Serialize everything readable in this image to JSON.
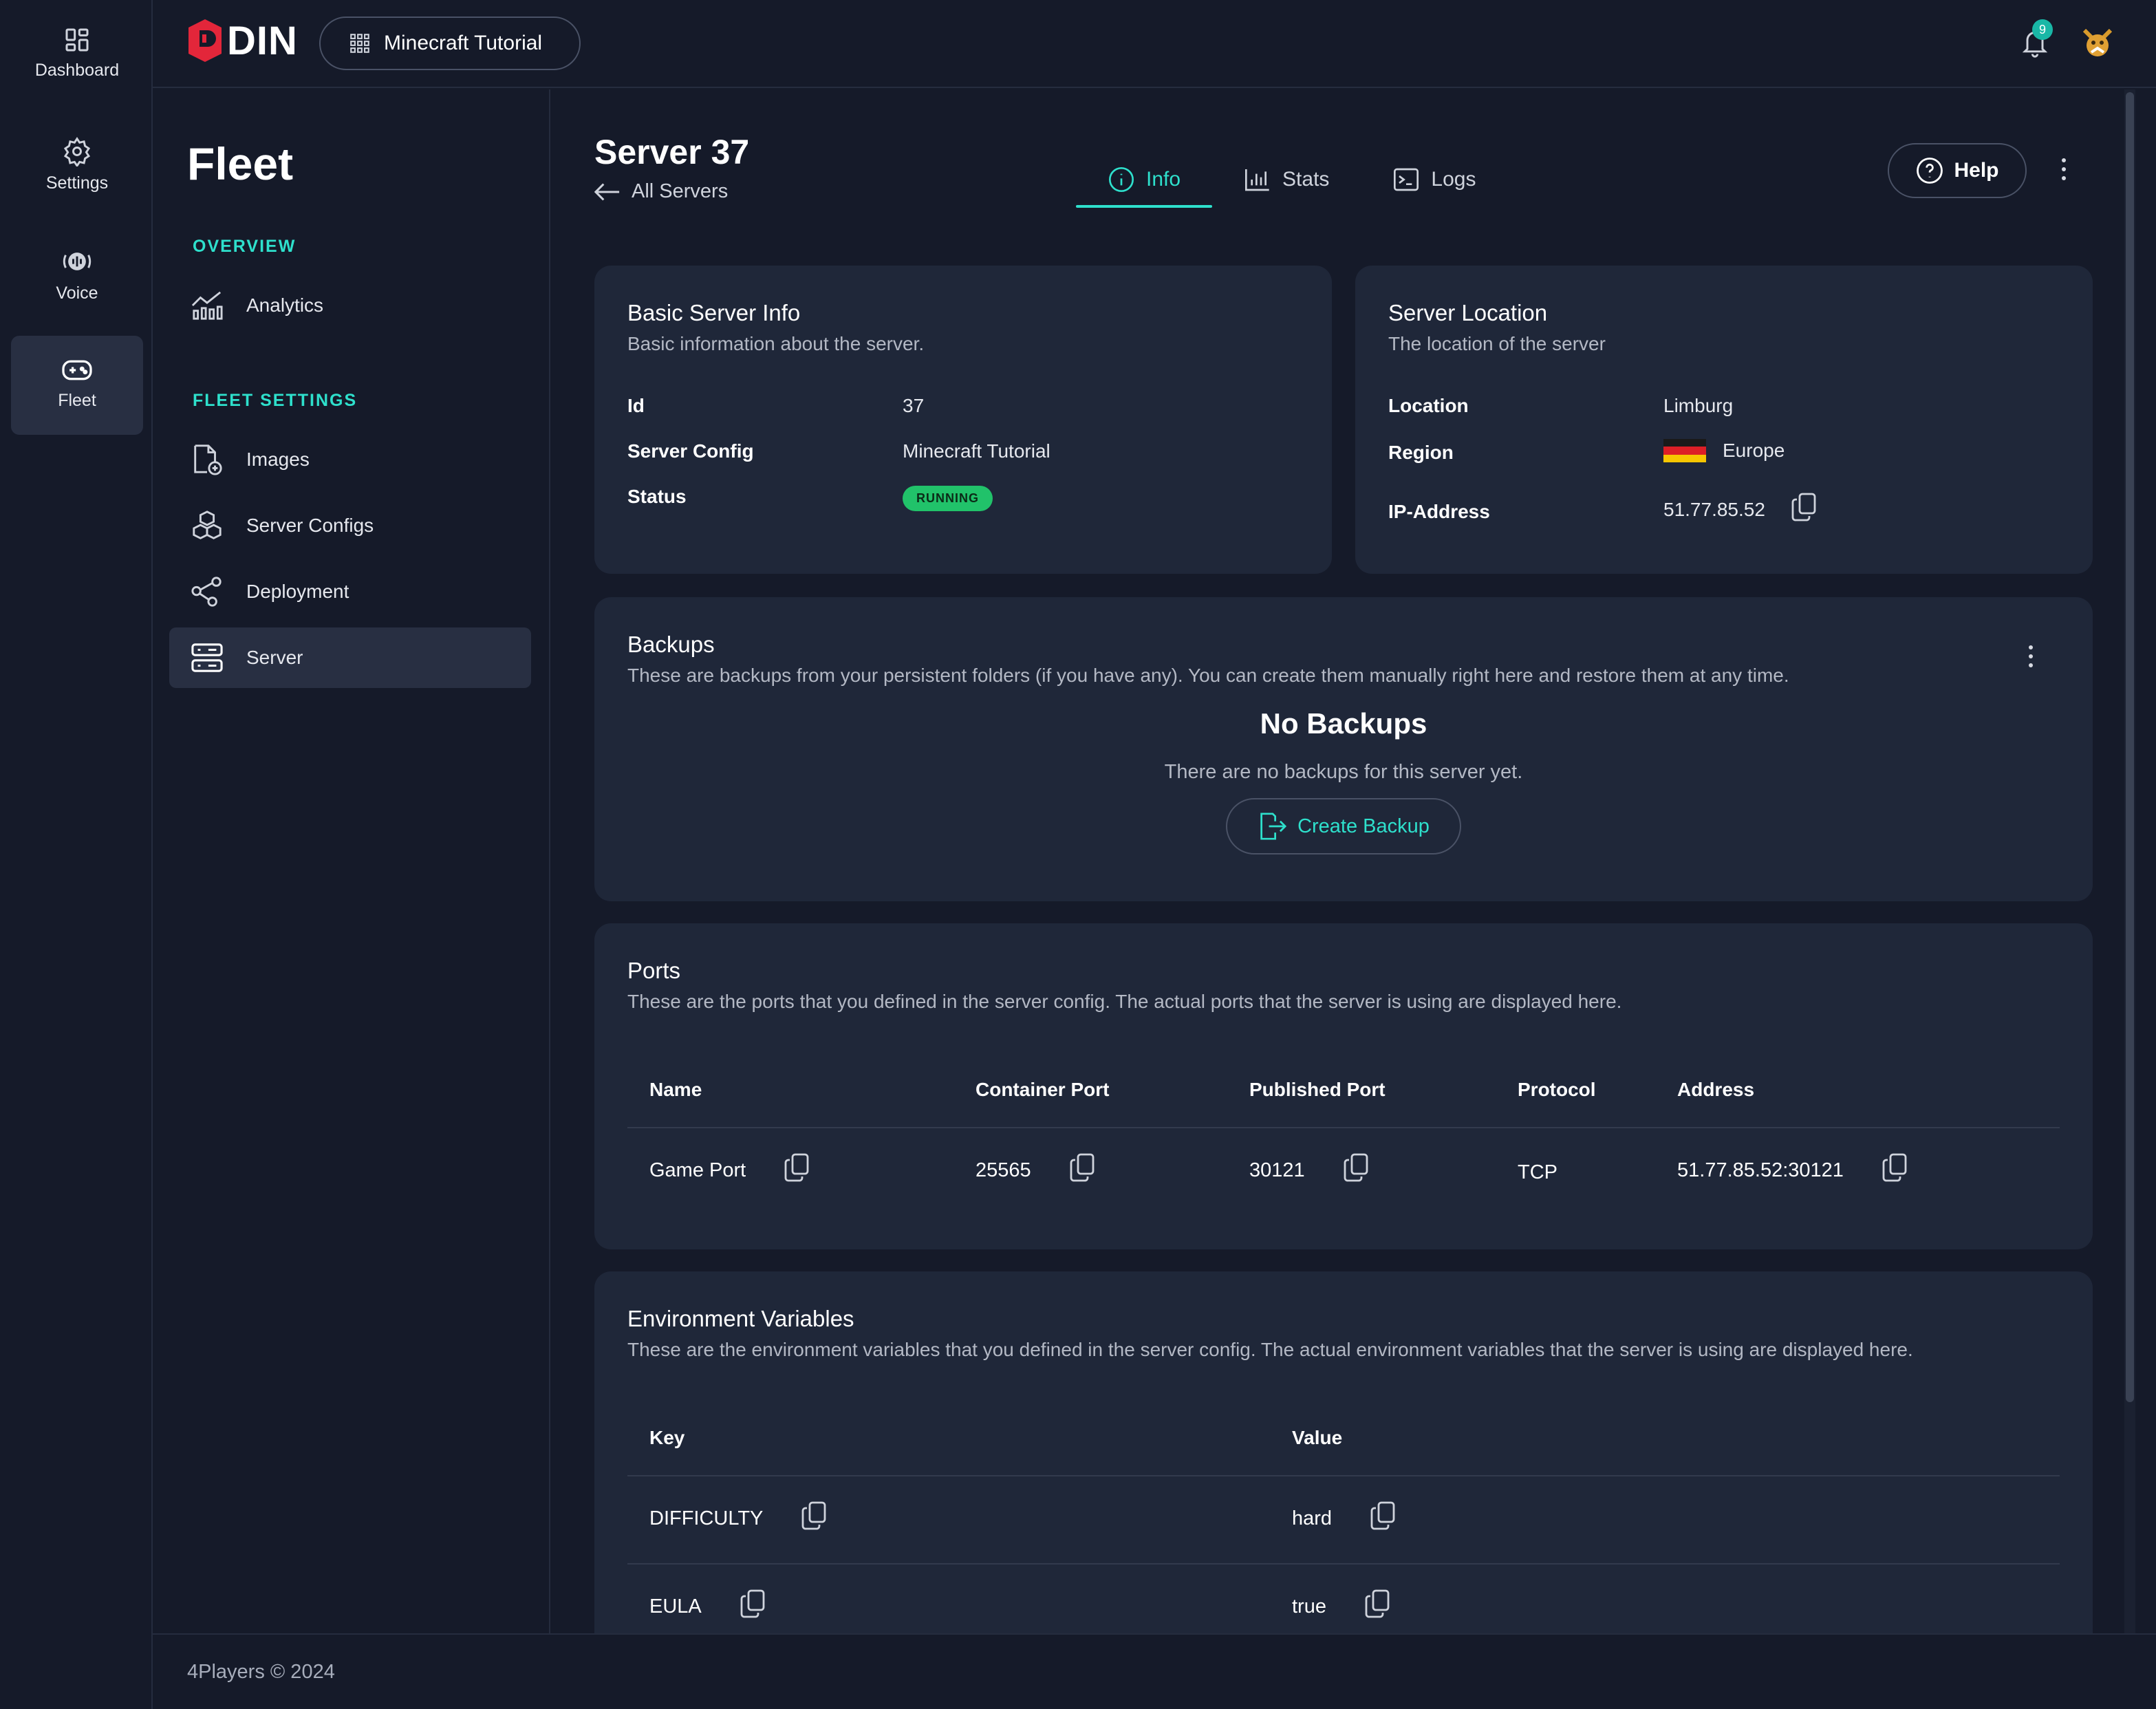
{
  "rail": {
    "items": [
      {
        "label": "Dashboard",
        "icon": "dashboard-icon"
      },
      {
        "label": "Settings",
        "icon": "gear-icon"
      },
      {
        "label": "Voice",
        "icon": "voice-icon"
      },
      {
        "label": "Fleet",
        "icon": "gamepad-icon",
        "active": true
      }
    ]
  },
  "topbar": {
    "logo_text": "DIN",
    "project_name": "Minecraft Tutorial",
    "notification_count": "9"
  },
  "sidebar": {
    "title": "Fleet",
    "overview_label": "OVERVIEW",
    "fleet_settings_label": "FLEET SETTINGS",
    "items": [
      {
        "label": "Analytics"
      },
      {
        "label": "Images"
      },
      {
        "label": "Server Configs"
      },
      {
        "label": "Deployment"
      },
      {
        "label": "Server"
      }
    ]
  },
  "page": {
    "title": "Server 37",
    "back_label": "All Servers",
    "tabs": [
      {
        "label": "Info",
        "active": true
      },
      {
        "label": "Stats"
      },
      {
        "label": "Logs"
      }
    ],
    "help_label": "Help"
  },
  "basic_info": {
    "title": "Basic Server Info",
    "subtitle": "Basic information about the server.",
    "id_label": "Id",
    "id_value": "37",
    "config_label": "Server Config",
    "config_value": "Minecraft Tutorial",
    "status_label": "Status",
    "status_value": "RUNNING"
  },
  "location": {
    "title": "Server Location",
    "subtitle": "The location of the server",
    "location_label": "Location",
    "location_value": "Limburg",
    "region_label": "Region",
    "region_value": "Europe",
    "ip_label": "IP-Address",
    "ip_value": "51.77.85.52"
  },
  "backups": {
    "title": "Backups",
    "subtitle": "These are backups from your persistent folders (if you have any). You can create them manually right here and restore them at any time.",
    "empty_title": "No Backups",
    "empty_subtitle": "There are no backups for this server yet.",
    "create_label": "Create Backup"
  },
  "ports": {
    "title": "Ports",
    "subtitle": "These are the ports that you defined in the server config. The actual ports that the server is using are displayed here.",
    "columns": [
      "Name",
      "Container Port",
      "Published Port",
      "Protocol",
      "Address"
    ],
    "rows": [
      {
        "name": "Game Port",
        "container_port": "25565",
        "published_port": "30121",
        "protocol": "TCP",
        "address": "51.77.85.52:30121"
      }
    ]
  },
  "env": {
    "title": "Environment Variables",
    "subtitle": "These are the environment variables that you defined in the server config. The actual environment variables that the server is using are displayed here.",
    "columns": [
      "Key",
      "Value"
    ],
    "rows": [
      {
        "key": "DIFFICULTY",
        "value": "hard"
      },
      {
        "key": "EULA",
        "value": "true"
      }
    ]
  },
  "footer": {
    "text": "4Players © 2024"
  },
  "colors": {
    "accent": "#2ee0cc",
    "background": "#151a29",
    "card": "#1f2739",
    "running": "#21c26a"
  }
}
